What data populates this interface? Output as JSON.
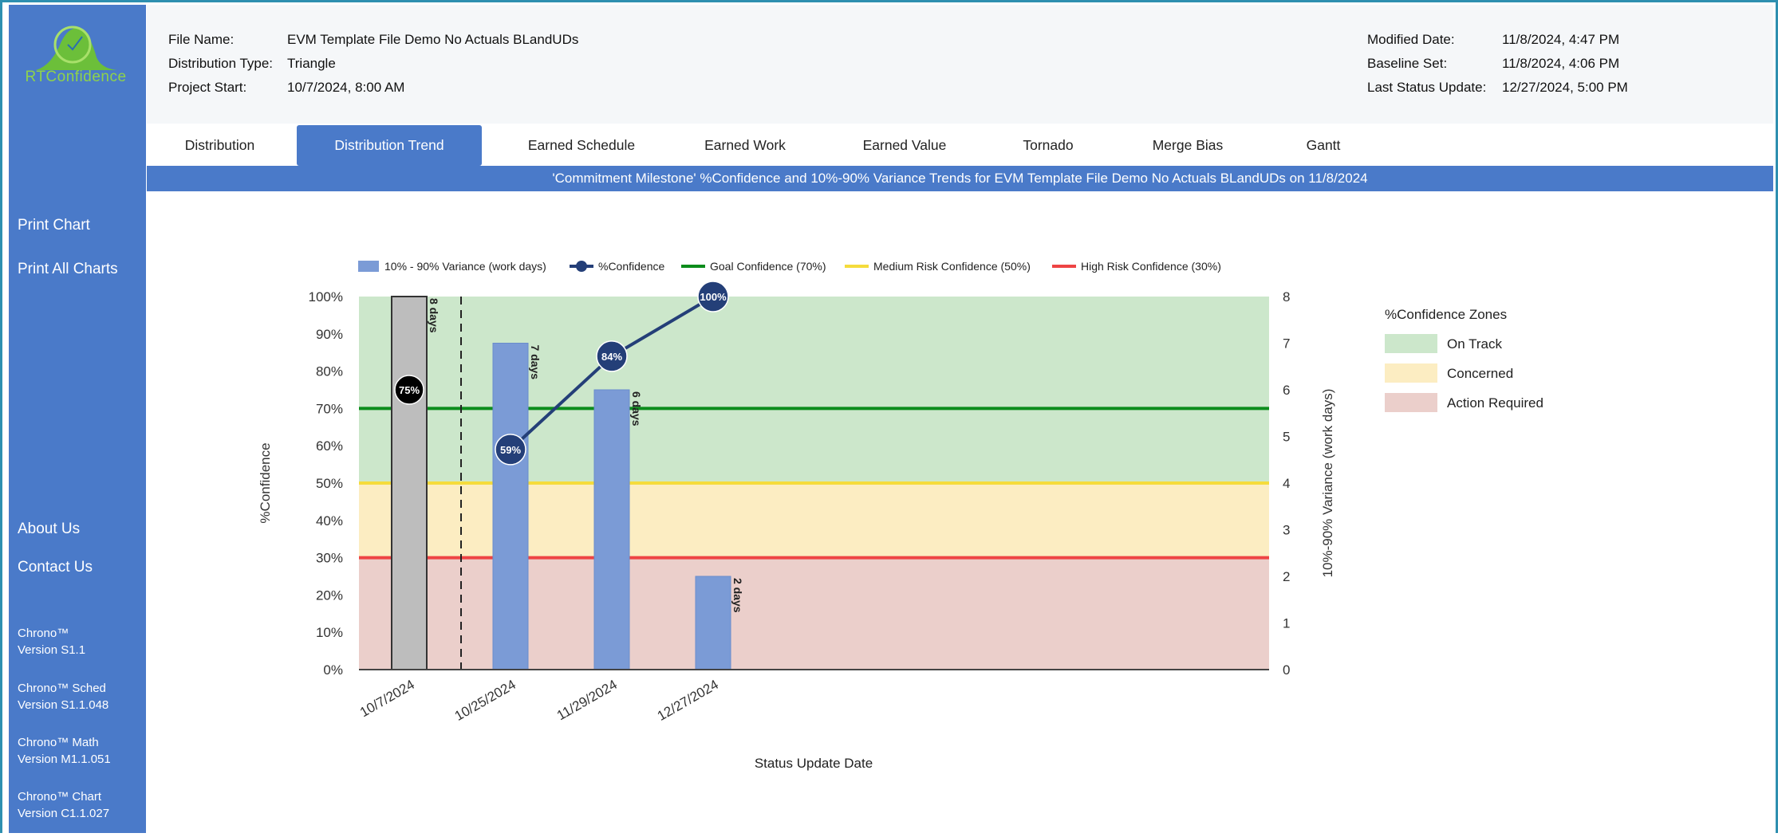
{
  "app": {
    "logo_text": "RTConfidence"
  },
  "sidebar": {
    "print_chart": "Print Chart",
    "print_all": "Print All Charts",
    "about": "About Us",
    "contact": "Contact Us",
    "versions": [
      {
        "name": "Chrono™",
        "version": "Version S1.1"
      },
      {
        "name": "Chrono™ Sched",
        "version": "Version S1.1.048"
      },
      {
        "name": "Chrono™ Math",
        "version": "Version M1.1.051"
      },
      {
        "name": "Chrono™ Chart",
        "version": "Version C1.1.027"
      }
    ]
  },
  "header": {
    "file_name_label": "File Name:",
    "file_name": "EVM Template File Demo No Actuals BLandUDs",
    "dist_type_label": "Distribution Type:",
    "dist_type": "Triangle",
    "project_start_label": "Project Start:",
    "project_start": "10/7/2024, 8:00 AM",
    "modified_label": "Modified Date:",
    "modified": "11/8/2024, 4:47 PM",
    "baseline_label": "Baseline Set:",
    "baseline": "11/8/2024, 4:06 PM",
    "last_status_label": "Last Status Update:",
    "last_status": "12/27/2024, 5:00 PM"
  },
  "tabs": [
    {
      "label": "Distribution",
      "active": false
    },
    {
      "label": "Distribution Trend",
      "active": true
    },
    {
      "label": "Earned Schedule",
      "active": false
    },
    {
      "label": "Earned Work",
      "active": false
    },
    {
      "label": "Earned Value",
      "active": false
    },
    {
      "label": "Tornado",
      "active": false
    },
    {
      "label": "Merge Bias",
      "active": false
    },
    {
      "label": "Gantt",
      "active": false
    }
  ],
  "banner": "'Commitment Milestone' %Confidence and 10%-90% Variance Trends for EVM Template File Demo No Actuals BLandUDs on 11/8/2024",
  "colors": {
    "sidebar": "#4a7ac9",
    "bar": "#7b9bd6",
    "bar_baseline": "#bdbdbd",
    "line": "#243f78",
    "goal": "#0c8c1c",
    "medium": "#f5dc3c",
    "high": "#ee4444",
    "zone_on_track": "#cce7cb",
    "zone_concerned": "#fcedc2",
    "zone_action": "#ebcfcb"
  },
  "chart_data": {
    "type": "bar",
    "categories": [
      "10/7/2024",
      "10/25/2024",
      "11/29/2024",
      "12/27/2024"
    ],
    "series": [
      {
        "name": "10% - 90% Variance (work days)",
        "values": [
          8,
          7,
          6,
          2
        ],
        "axis": "right",
        "kind": "bar"
      },
      {
        "name": "%Confidence",
        "values": [
          75,
          59,
          84,
          100
        ],
        "axis": "left",
        "kind": "line"
      }
    ],
    "bar_labels": [
      "8 days",
      "7 days",
      "6 days",
      "2 days"
    ],
    "point_labels": [
      "75%",
      "59%",
      "84%",
      "100%"
    ],
    "reference_lines": [
      {
        "name": "Goal Confidence (70%)",
        "value": 70
      },
      {
        "name": "Medium Risk Confidence (50%)",
        "value": 50
      },
      {
        "name": "High Risk Confidence (30%)",
        "value": 30
      }
    ],
    "zones_title": "%Confidence Zones",
    "zones": [
      {
        "name": "On Track",
        "from": 50,
        "to": 100
      },
      {
        "name": "Concerned",
        "from": 30,
        "to": 50
      },
      {
        "name": "Action Required",
        "from": 0,
        "to": 30
      }
    ],
    "ylabel": "%Confidence",
    "y2label": "10%-90% Variance (work days)",
    "xlabel": "Status Update Date",
    "ylim": [
      0,
      100
    ],
    "y2lim": [
      0,
      8
    ],
    "yticks": [
      "0%",
      "10%",
      "20%",
      "30%",
      "40%",
      "50%",
      "60%",
      "70%",
      "80%",
      "90%",
      "100%"
    ],
    "y2ticks": [
      "0",
      "1",
      "2",
      "3",
      "4",
      "5",
      "6",
      "7",
      "8"
    ],
    "legend_position": "top"
  }
}
